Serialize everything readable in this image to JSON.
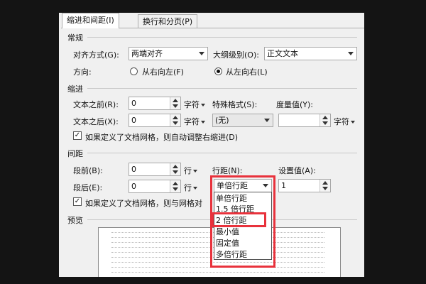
{
  "tabs": {
    "indent_spacing": "缩进和间距(I)",
    "line_page": "换行和分页(P)"
  },
  "general": {
    "section": "常规",
    "alignment_label": "对齐方式(G):",
    "alignment_value": "两端对齐",
    "outline_label": "大纲级别(O):",
    "outline_value": "正文文本",
    "direction_label": "方向:",
    "rtl_label": "从右向左(F)",
    "ltr_label": "从左向右(L)"
  },
  "indent": {
    "section": "缩进",
    "before_label": "文本之前(R):",
    "before_value": "0",
    "before_unit": "字符",
    "after_label": "文本之后(X):",
    "after_value": "0",
    "after_unit": "字符",
    "special_label": "特殊格式(S):",
    "special_value": "(无)",
    "measure_label": "度量值(Y):",
    "measure_value": "",
    "measure_unit": "字符",
    "grid_check": "如果定义了文档网格，则自动调整右缩进(D)"
  },
  "spacing": {
    "section": "间距",
    "before_label": "段前(B):",
    "before_value": "0",
    "before_unit": "行",
    "after_label": "段后(E):",
    "after_value": "0",
    "after_unit": "行",
    "line_label": "行距(N):",
    "line_value": "单倍行距",
    "setting_label": "设置值(A):",
    "setting_value": "1",
    "grid_check": "如果定义了文档网格，则与网格对"
  },
  "preview": {
    "section": "预览"
  },
  "line_spacing_options": [
    "单倍行距",
    "1.5 倍行距",
    "2 倍行距",
    "最小值",
    "固定值",
    "多倍行距"
  ],
  "colors": {
    "highlight": "#e8323c",
    "dialog_bg": "#f0f0f0",
    "background": "#141414"
  }
}
